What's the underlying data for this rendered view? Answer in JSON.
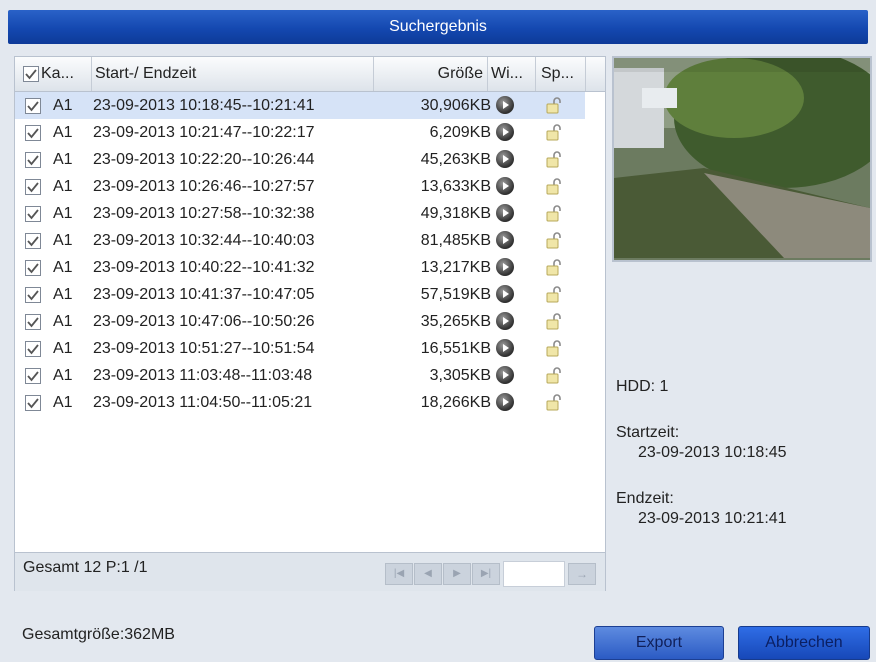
{
  "title": "Suchergebnis",
  "table": {
    "headers": [
      "Ka...",
      "Start-/ Endzeit",
      "Größe",
      "Wi...",
      "Sp..."
    ],
    "rows": [
      {
        "cam": "A1",
        "time": "23-09-2013 10:18:45--10:21:41",
        "size": "30,906KB",
        "selected": true
      },
      {
        "cam": "A1",
        "time": "23-09-2013 10:21:47--10:22:17",
        "size": "6,209KB"
      },
      {
        "cam": "A1",
        "time": "23-09-2013 10:22:20--10:26:44",
        "size": "45,263KB"
      },
      {
        "cam": "A1",
        "time": "23-09-2013 10:26:46--10:27:57",
        "size": "13,633KB"
      },
      {
        "cam": "A1",
        "time": "23-09-2013 10:27:58--10:32:38",
        "size": "49,318KB"
      },
      {
        "cam": "A1",
        "time": "23-09-2013 10:32:44--10:40:03",
        "size": "81,485KB"
      },
      {
        "cam": "A1",
        "time": "23-09-2013 10:40:22--10:41:32",
        "size": "13,217KB"
      },
      {
        "cam": "A1",
        "time": "23-09-2013 10:41:37--10:47:05",
        "size": "57,519KB"
      },
      {
        "cam": "A1",
        "time": "23-09-2013 10:47:06--10:50:26",
        "size": "35,265KB"
      },
      {
        "cam": "A1",
        "time": "23-09-2013 10:51:27--10:51:54",
        "size": "16,551KB"
      },
      {
        "cam": "A1",
        "time": "23-09-2013 11:03:48--11:03:48",
        "size": "3,305KB"
      },
      {
        "cam": "A1",
        "time": "23-09-2013 11:04:50--11:05:21",
        "size": "18,266KB"
      }
    ]
  },
  "footer": {
    "total": "Gesamt 12 P:1 /1"
  },
  "info": {
    "hdd": "HDD: 1",
    "start_label": "Startzeit:",
    "start_value": "23-09-2013 10:18:45",
    "end_label": "Endzeit:",
    "end_value": "23-09-2013 10:21:41"
  },
  "status": "Gesamtgröße:362MB",
  "buttons": {
    "export": "Export",
    "cancel": "Abbrechen"
  },
  "icons": {
    "row_action": "play-icon",
    "lock": "unlock-icon"
  },
  "colors": {
    "titlebar": "#1448b0",
    "selection": "#d6e3f7",
    "button": "#2b5bc4"
  }
}
